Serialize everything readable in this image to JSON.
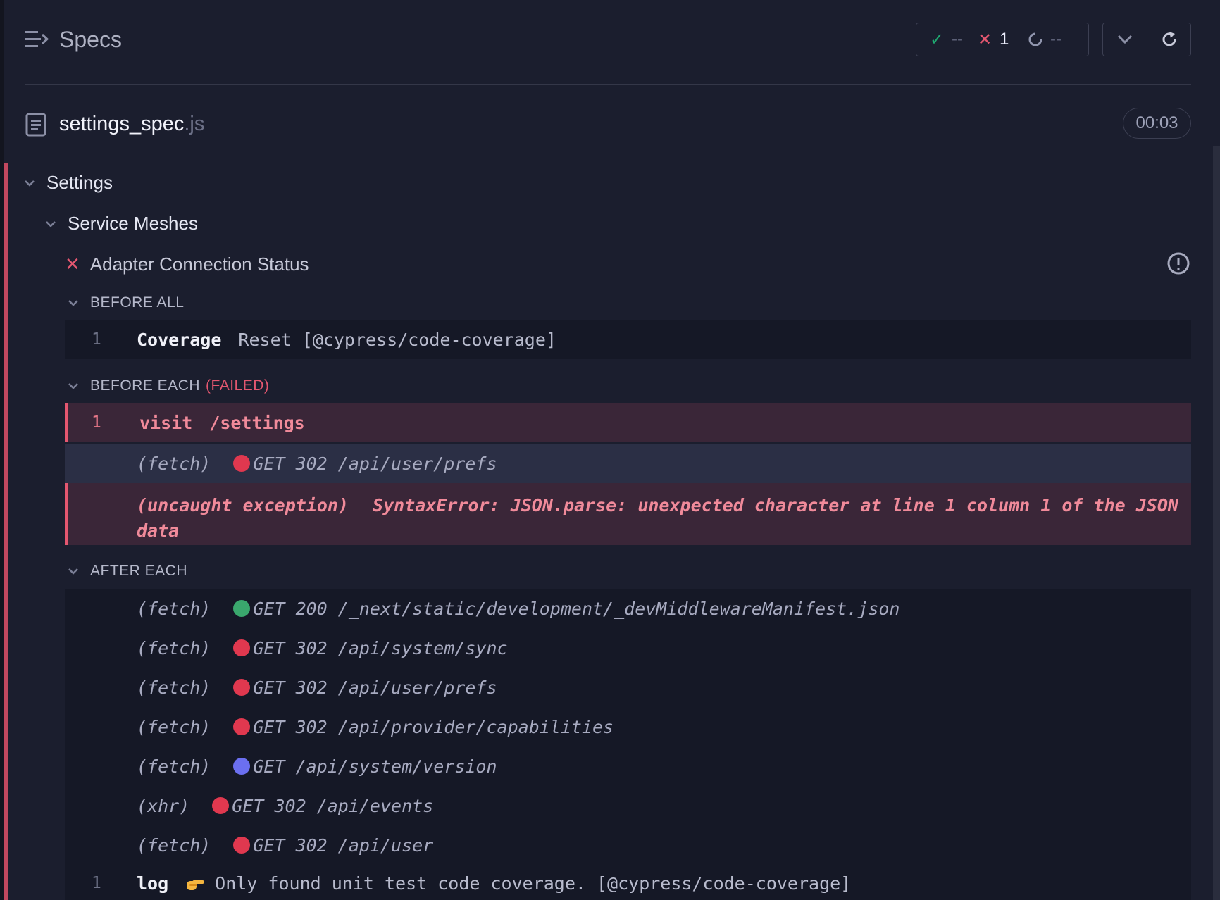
{
  "header": {
    "title": "Specs",
    "stats": {
      "passed": "--",
      "failed": "1",
      "pending": "--"
    }
  },
  "file": {
    "name": "settings_spec",
    "ext": ".js",
    "duration": "00:03"
  },
  "suites": {
    "root": "Settings",
    "child": "Service Meshes",
    "test": "Adapter Connection Status"
  },
  "hooks": {
    "before_all": {
      "label": "BEFORE ALL",
      "commands": [
        {
          "num": "1",
          "name": "Coverage",
          "message": "Reset [@cypress/code-coverage]"
        }
      ]
    },
    "before_each": {
      "label": "BEFORE EACH",
      "failed_label": "(FAILED)",
      "command": {
        "num": "1",
        "name": "visit",
        "message": "/settings"
      },
      "fetch": {
        "kind": "(fetch)",
        "request": "GET 302 /api/user/prefs",
        "status_color": "#e0384f"
      },
      "exception": {
        "kind": "(uncaught exception)",
        "message": "SyntaxError: JSON.parse: unexpected character at line 1 column 1 of the JSON data"
      }
    },
    "after_each": {
      "label": "AFTER EACH",
      "requests": [
        {
          "kind": "(fetch)",
          "request": "GET 200 /_next/static/development/_devMiddlewareManifest.json",
          "status_color": "#3aa76d"
        },
        {
          "kind": "(fetch)",
          "request": "GET 302 /api/system/sync",
          "status_color": "#e0384f"
        },
        {
          "kind": "(fetch)",
          "request": "GET 302 /api/user/prefs",
          "status_color": "#e0384f"
        },
        {
          "kind": "(fetch)",
          "request": "GET 302 /api/provider/capabilities",
          "status_color": "#e0384f"
        },
        {
          "kind": "(fetch)",
          "request": "GET /api/system/version",
          "status_color": "#6b6ff0"
        },
        {
          "kind": "(xhr)",
          "request": "GET 302 /api/events",
          "status_color": "#e0384f"
        },
        {
          "kind": "(fetch)",
          "request": "GET 302 /api/user",
          "status_color": "#e0384f"
        }
      ],
      "log": {
        "num": "1",
        "name": "log",
        "icon": "pointing-hand-icon",
        "message": "Only found unit test code coverage. [@cypress/code-coverage]"
      }
    }
  }
}
